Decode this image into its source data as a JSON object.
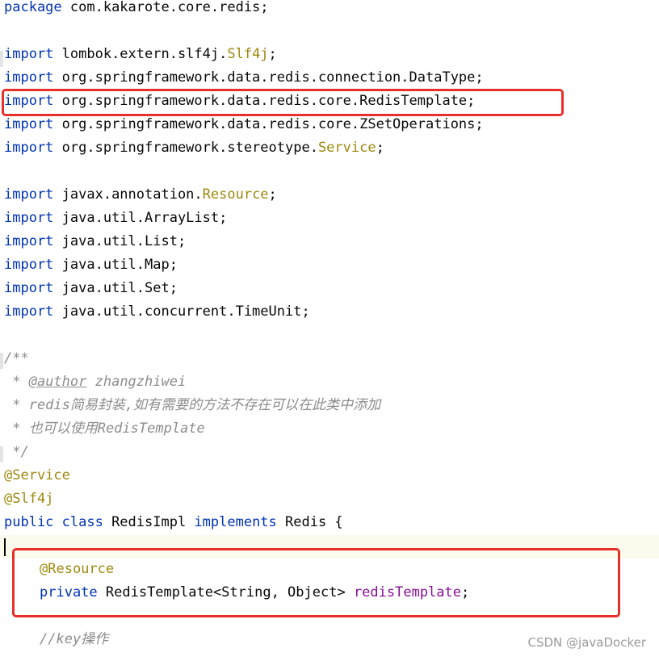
{
  "code_lines": [
    {
      "id": "package",
      "tokens": [
        {
          "t": "package",
          "c": "kw"
        },
        {
          "t": " com.kakarote.core.redis;",
          "c": "plain"
        }
      ]
    },
    {
      "id": "blank1",
      "tokens": []
    },
    {
      "id": "import-slf4j",
      "tokens": [
        {
          "t": "import",
          "c": "kw"
        },
        {
          "t": " lombok.extern.slf4j.",
          "c": "plain"
        },
        {
          "t": "Slf4j",
          "c": "cls"
        },
        {
          "t": ";",
          "c": "plain"
        }
      ]
    },
    {
      "id": "import-datatype",
      "tokens": [
        {
          "t": "import",
          "c": "kw"
        },
        {
          "t": " org.springframework.data.redis.connection.DataType;",
          "c": "plain"
        }
      ]
    },
    {
      "id": "import-redistemplate",
      "tokens": [
        {
          "t": "import",
          "c": "kw"
        },
        {
          "t": " org.springframework.data.redis.core.RedisTemplate;",
          "c": "plain"
        }
      ]
    },
    {
      "id": "import-zsetoperations",
      "tokens": [
        {
          "t": "import",
          "c": "kw"
        },
        {
          "t": " org.springframework.data.redis.core.ZSetOperations;",
          "c": "plain"
        }
      ]
    },
    {
      "id": "import-service",
      "tokens": [
        {
          "t": "import",
          "c": "kw"
        },
        {
          "t": " org.springframework.stereotype.",
          "c": "plain"
        },
        {
          "t": "Service",
          "c": "cls"
        },
        {
          "t": ";",
          "c": "plain"
        }
      ]
    },
    {
      "id": "blank2",
      "tokens": []
    },
    {
      "id": "import-resource",
      "tokens": [
        {
          "t": "import",
          "c": "kw"
        },
        {
          "t": " javax.annotation.",
          "c": "plain"
        },
        {
          "t": "Resource",
          "c": "cls"
        },
        {
          "t": ";",
          "c": "plain"
        }
      ]
    },
    {
      "id": "import-arraylist",
      "tokens": [
        {
          "t": "import",
          "c": "kw"
        },
        {
          "t": " java.util.ArrayList;",
          "c": "plain"
        }
      ]
    },
    {
      "id": "import-list",
      "tokens": [
        {
          "t": "import",
          "c": "kw"
        },
        {
          "t": " java.util.List;",
          "c": "plain"
        }
      ]
    },
    {
      "id": "import-map",
      "tokens": [
        {
          "t": "import",
          "c": "kw"
        },
        {
          "t": " java.util.Map;",
          "c": "plain"
        }
      ]
    },
    {
      "id": "import-set",
      "tokens": [
        {
          "t": "import",
          "c": "kw"
        },
        {
          "t": " java.util.Set;",
          "c": "plain"
        }
      ]
    },
    {
      "id": "import-timeunit",
      "tokens": [
        {
          "t": "import",
          "c": "kw"
        },
        {
          "t": " java.util.concurrent.TimeUnit;",
          "c": "plain"
        }
      ]
    },
    {
      "id": "blank3",
      "tokens": []
    },
    {
      "id": "doc-open",
      "tokens": [
        {
          "t": "/**",
          "c": "doc"
        }
      ]
    },
    {
      "id": "doc-author",
      "tokens": [
        {
          "t": " * ",
          "c": "doc"
        },
        {
          "t": "@author",
          "c": "doc doc-tag"
        },
        {
          "t": " zhangzhiwei",
          "c": "doc"
        }
      ]
    },
    {
      "id": "doc-desc1",
      "tokens": [
        {
          "t": " * redis简易封装,如有需要的方法不存在可以在此类中添加",
          "c": "doc"
        }
      ]
    },
    {
      "id": "doc-desc2",
      "tokens": [
        {
          "t": " * 也可以使用RedisTemplate",
          "c": "doc"
        }
      ]
    },
    {
      "id": "doc-close",
      "tokens": [
        {
          "t": " */",
          "c": "doc"
        }
      ]
    },
    {
      "id": "ann-service",
      "tokens": [
        {
          "t": "@Service",
          "c": "ann"
        }
      ]
    },
    {
      "id": "ann-slf4j",
      "tokens": [
        {
          "t": "@Slf4j",
          "c": "ann"
        }
      ]
    },
    {
      "id": "class-decl",
      "tokens": [
        {
          "t": "public class",
          "c": "kw"
        },
        {
          "t": " RedisImpl ",
          "c": "plain"
        },
        {
          "t": "implements",
          "c": "kw"
        },
        {
          "t": " Redis {",
          "c": "plain"
        }
      ]
    },
    {
      "id": "blank-current",
      "tokens": []
    },
    {
      "id": "ann-resource",
      "indent": true,
      "tokens": [
        {
          "t": "@Resource",
          "c": "ann"
        }
      ]
    },
    {
      "id": "field-redistemplate",
      "indent": true,
      "tokens": [
        {
          "t": "private",
          "c": "kw"
        },
        {
          "t": " RedisTemplate<String, Object> ",
          "c": "plain"
        },
        {
          "t": "redisTemplate",
          "c": "field"
        },
        {
          "t": ";",
          "c": "plain"
        }
      ]
    },
    {
      "id": "blank4",
      "tokens": []
    },
    {
      "id": "comment-key",
      "indent": true,
      "tokens": [
        {
          "t": "//key操作",
          "c": "cmt"
        }
      ]
    }
  ],
  "watermark": "CSDN @javaDocker",
  "colors": {
    "keyword": "#0033b3",
    "annotation": "#9e880d",
    "field": "#871094",
    "comment": "#8c8c8c",
    "highlight_box": "#e8302a",
    "current_line": "#fcfaed"
  }
}
